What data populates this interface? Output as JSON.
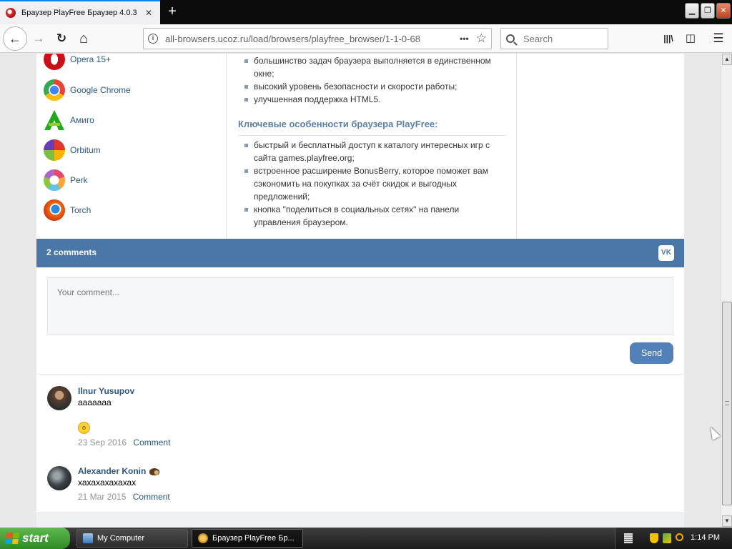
{
  "window": {
    "tab_title": "Браузер PlayFree Браузер 4.0.3",
    "tab_close": "✕",
    "new_tab": "+",
    "minimize": "▁",
    "restore": "❐",
    "close": "✕"
  },
  "toolbar": {
    "back": "←",
    "forward": "→",
    "reload": "↻",
    "home": "⌂",
    "url": "all-browsers.ucoz.ru/load/browsers/playfree_browser/1-1-0-68",
    "page_actions": "•••",
    "bookmark": "☆",
    "search_placeholder": "Search",
    "library": "|||\\",
    "sidebar": "◫",
    "menu": "☰"
  },
  "browser_list": [
    {
      "name": "Opera 15+",
      "icon": "opera-icon",
      "color": "#cc0f16"
    },
    {
      "name": "Google Chrome",
      "icon": "chrome-icon",
      "color": "#4285f4"
    },
    {
      "name": "Амиго",
      "icon": "amigo-icon",
      "color": "#22a81e"
    },
    {
      "name": "Orbitum",
      "icon": "orbitum-icon",
      "color": "#e5352b"
    },
    {
      "name": "Perk",
      "icon": "perk-icon",
      "color": "#e44b6a"
    },
    {
      "name": "Torch",
      "icon": "torch-icon",
      "color": "#f06a12"
    }
  ],
  "article": {
    "bullets_top": [
      "большинство задач браузера выполняется в единственном окне;",
      "высокий уровень безопасности и скорости работы;",
      "улучшенная поддержка HTML5."
    ],
    "features_heading": "Ключевые особенности браузера PlayFree:",
    "features": [
      "быстрый и бесплатный доступ к каталогу интересных игр с сайта games.playfree.org;",
      "встроенное расширение BonusBerry, которое поможет вам сэкономить на покупках за счёт скидок и выгодных предложений;",
      "кнопка \"поделиться в социальных сетях\" на панели управления браузером."
    ]
  },
  "comments_widget": {
    "count_label": "2 comments",
    "vk_label": "VK",
    "input_placeholder": "Your comment...",
    "send_label": "Send",
    "header_color": "#4a76a8",
    "comments": [
      {
        "author": "Ilnur Yusupov",
        "text": "ааааааа",
        "emoji": "😮",
        "date": "23 Sep 2016",
        "reply_label": "Comment"
      },
      {
        "author": "Alexander Konin",
        "text": "хахахахахахах",
        "date": "21 Mar 2015",
        "reply_label": "Comment"
      }
    ]
  },
  "taskbar": {
    "start_label": "start",
    "items": [
      {
        "label": "My Computer",
        "icon": "computer-icon"
      },
      {
        "label": "Браузер PlayFree Бр...",
        "icon": "playfree-icon"
      }
    ],
    "clock": "1:14 PM"
  }
}
